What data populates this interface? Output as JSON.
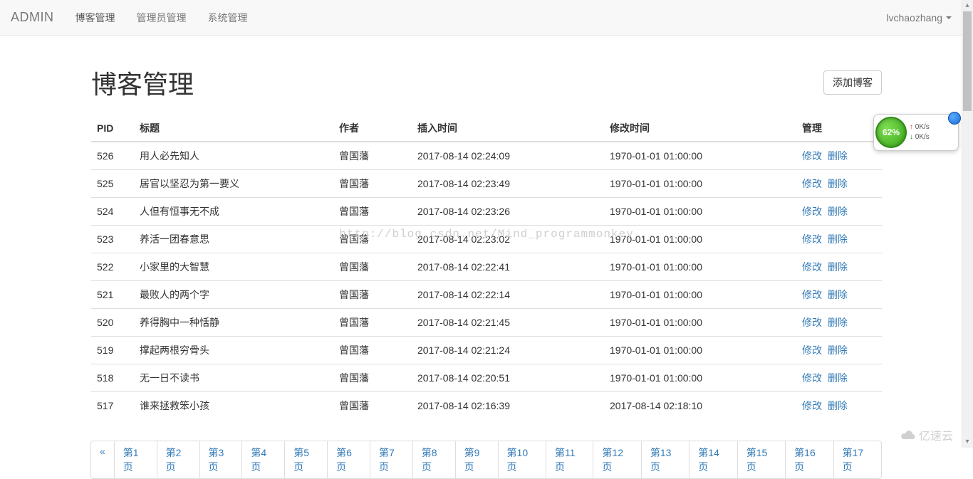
{
  "nav": {
    "brand": "ADMIN",
    "items": [
      "博客管理",
      "管理员管理",
      "系统管理"
    ],
    "user": "lvchaozhang"
  },
  "page": {
    "title": "博客管理",
    "add_button": "添加博客"
  },
  "table": {
    "headers": {
      "pid": "PID",
      "title": "标题",
      "author": "作者",
      "insert_time": "插入时间",
      "mod_time": "修改时间",
      "actions": "管理"
    },
    "action_labels": {
      "edit": "修改",
      "delete": "删除"
    },
    "rows": [
      {
        "pid": "526",
        "title": "用人必先知人",
        "author": "曾国藩",
        "insert_time": "2017-08-14 02:24:09",
        "mod_time": "1970-01-01 01:00:00"
      },
      {
        "pid": "525",
        "title": "居官以坚忍为第一要义",
        "author": "曾国藩",
        "insert_time": "2017-08-14 02:23:49",
        "mod_time": "1970-01-01 01:00:00"
      },
      {
        "pid": "524",
        "title": "人但有恒事无不成",
        "author": "曾国藩",
        "insert_time": "2017-08-14 02:23:26",
        "mod_time": "1970-01-01 01:00:00"
      },
      {
        "pid": "523",
        "title": "养活一团春意思",
        "author": "曾国藩",
        "insert_time": "2017-08-14 02:23:02",
        "mod_time": "1970-01-01 01:00:00"
      },
      {
        "pid": "522",
        "title": "小家里的大智慧",
        "author": "曾国藩",
        "insert_time": "2017-08-14 02:22:41",
        "mod_time": "1970-01-01 01:00:00"
      },
      {
        "pid": "521",
        "title": "最败人的两个字",
        "author": "曾国藩",
        "insert_time": "2017-08-14 02:22:14",
        "mod_time": "1970-01-01 01:00:00"
      },
      {
        "pid": "520",
        "title": "养得胸中一种恬静",
        "author": "曾国藩",
        "insert_time": "2017-08-14 02:21:45",
        "mod_time": "1970-01-01 01:00:00"
      },
      {
        "pid": "519",
        "title": "撑起两根穷骨头",
        "author": "曾国藩",
        "insert_time": "2017-08-14 02:21:24",
        "mod_time": "1970-01-01 01:00:00"
      },
      {
        "pid": "518",
        "title": "无一日不读书",
        "author": "曾国藩",
        "insert_time": "2017-08-14 02:20:51",
        "mod_time": "1970-01-01 01:00:00"
      },
      {
        "pid": "517",
        "title": "谁来拯救笨小孩",
        "author": "曾国藩",
        "insert_time": "2017-08-14 02:16:39",
        "mod_time": "2017-08-14 02:18:10"
      }
    ]
  },
  "pagination": {
    "prev": "«",
    "pages": [
      "第1页",
      "第2页",
      "第3页",
      "第4页",
      "第5页",
      "第6页",
      "第7页",
      "第8页",
      "第9页",
      "第10页",
      "第11页",
      "第12页",
      "第13页",
      "第14页",
      "第15页",
      "第16页",
      "第17页"
    ]
  },
  "watermarks": {
    "center": "http://blog.csdn.net/Mind_programmonkey",
    "corner": "亿速云"
  },
  "widget": {
    "percent": "62%",
    "up": "0K/s",
    "down": "0K/s"
  }
}
